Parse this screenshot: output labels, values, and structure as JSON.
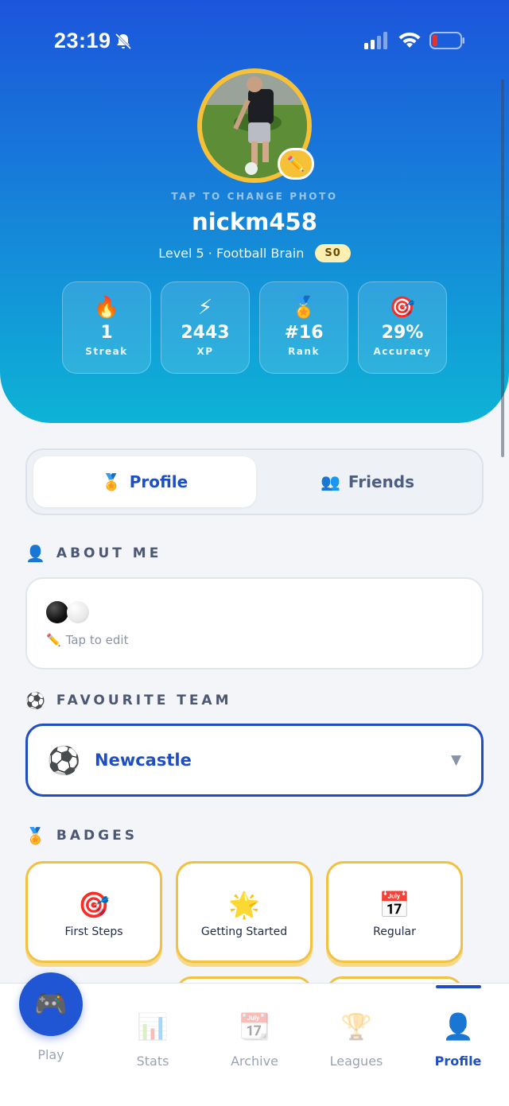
{
  "status_bar": {
    "time": "23:19"
  },
  "profile": {
    "tap_photo": "TAP TO CHANGE PHOTO",
    "edit_photo_icon": "pencil-icon",
    "username": "nickm458",
    "level": "Level 5 · Football Brain",
    "season": "S0"
  },
  "stats": [
    {
      "icon": "🔥",
      "value": "1",
      "label": "Streak"
    },
    {
      "icon": "⚡",
      "value": "2443",
      "label": "XP"
    },
    {
      "icon": "🏅",
      "value": "#16",
      "label": "Rank"
    },
    {
      "icon": "🎯",
      "value": "29%",
      "label": "Accuracy"
    }
  ],
  "tabs": {
    "profile": {
      "icon": "🏅",
      "label": "Profile"
    },
    "friends": {
      "icon": "👥",
      "label": "Friends"
    }
  },
  "about": {
    "heading": "ABOUT ME",
    "heading_icon": "👤",
    "edit_hint": "Tap to edit",
    "edit_icon": "✏️"
  },
  "team": {
    "heading": "FAVOURITE TEAM",
    "heading_icon": "⚽",
    "icon": "⚽",
    "name": "Newcastle",
    "caret": "▼"
  },
  "badges": {
    "heading": "BADGES",
    "heading_icon": "🏅",
    "items": [
      {
        "icon": "🎯",
        "label": "First Steps"
      },
      {
        "icon": "🌟",
        "label": "Getting Started"
      },
      {
        "icon": "📅",
        "label": "Regular"
      }
    ]
  },
  "nav": {
    "play": {
      "icon": "🎮",
      "label": "Play"
    },
    "stats": {
      "icon": "📊",
      "label": "Stats"
    },
    "archive": {
      "icon": "📆",
      "label": "Archive"
    },
    "leagues": {
      "icon": "🏆",
      "label": "Leagues"
    },
    "profile": {
      "icon": "👤",
      "label": "Profile"
    }
  },
  "colors": {
    "accent": "#1f4ec3",
    "badge_border": "#f3c140",
    "hero_top": "#1c55dc",
    "hero_bottom": "#0db3d6"
  }
}
